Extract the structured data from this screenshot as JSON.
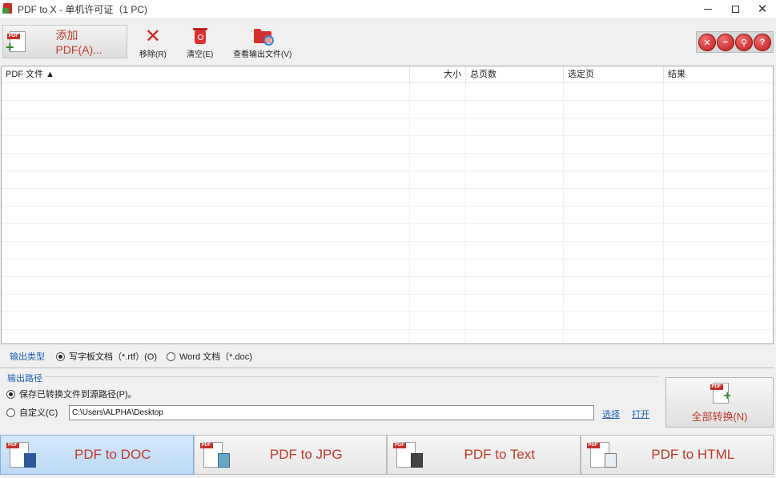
{
  "window": {
    "title": "PDF to X - 单机许可证（1 PC)"
  },
  "toolbar": {
    "add_pdf_label": "添加 PDF(A)...",
    "remove_label": "移除(R)",
    "clear_label": "清空(E)",
    "view_output_label": "查看输出文件(V)",
    "round_buttons": [
      "close-icon",
      "minus-icon",
      "search-icon",
      "help-icon"
    ]
  },
  "file_list": {
    "columns": [
      "PDF 文件 ▲",
      "大小",
      "总页数",
      "选定页",
      "结果"
    ],
    "rows": []
  },
  "output_type": {
    "label": "输出类型",
    "options": [
      {
        "label": "写字板文档（*.rtf）(O)",
        "selected": true
      },
      {
        "label": "Word 文档（*.doc)",
        "selected": false
      }
    ]
  },
  "output_path": {
    "label": "输出路径",
    "save_to_source_label": "保存已转换文件到源路径(P)。",
    "save_to_source_selected": true,
    "custom_label": "自定义(C)",
    "custom_selected": false,
    "custom_path": "C:\\Users\\ALPHA\\Desktop",
    "browse_label": "选择",
    "open_label": "打开"
  },
  "convert_all_label": "全部转换(N)",
  "tabs": [
    {
      "label": "PDF to DOC",
      "active": true
    },
    {
      "label": "PDF to JPG",
      "active": false
    },
    {
      "label": "PDF to Text",
      "active": false
    },
    {
      "label": "PDF to HTML",
      "active": false
    }
  ],
  "colors": {
    "accent_red": "#c0392b",
    "link_blue": "#1a5fb4",
    "active_tab": "#c9e1f8"
  }
}
